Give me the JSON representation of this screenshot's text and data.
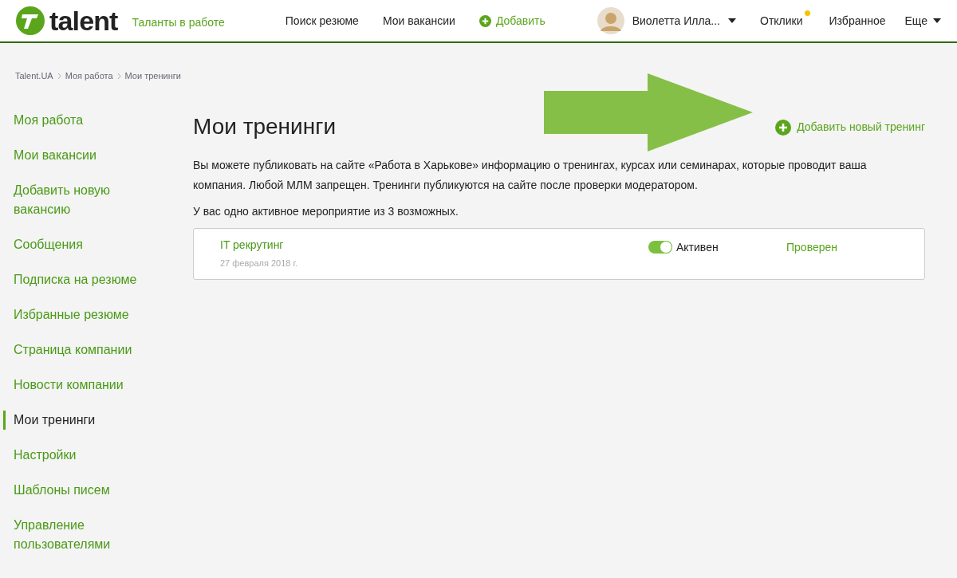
{
  "header": {
    "logo_text": "talent",
    "tagline": "Таланты в работе",
    "nav": [
      {
        "label": "Поиск резюме",
        "kind": "link"
      },
      {
        "label": "Мои вакансии",
        "kind": "link"
      },
      {
        "label": "Добавить",
        "kind": "add"
      }
    ],
    "user": {
      "name": "Виолетта Илла..."
    },
    "right_nav": [
      {
        "label": "Отклики",
        "notification": true,
        "dropdown": false
      },
      {
        "label": "Избранное",
        "notification": false,
        "dropdown": false
      },
      {
        "label": "Еще",
        "notification": false,
        "dropdown": true
      }
    ]
  },
  "breadcrumbs": [
    "Talent.UA",
    "Моя работа",
    "Мои тренинги"
  ],
  "sidebar": {
    "items": [
      {
        "label": "Моя работа",
        "selected": false
      },
      {
        "label": "Мои вакансии",
        "selected": false
      },
      {
        "label": "Добавить новую вакансию",
        "selected": false
      },
      {
        "label": "Сообщения",
        "selected": false
      },
      {
        "label": "Подписка на резюме",
        "selected": false
      },
      {
        "label": "Избранные резюме",
        "selected": false
      },
      {
        "label": "Страница компании",
        "selected": false
      },
      {
        "label": "Новости компании",
        "selected": false
      },
      {
        "label": "Мои тренинги",
        "selected": true
      },
      {
        "label": "Настройки",
        "selected": false
      },
      {
        "label": "Шаблоны писем",
        "selected": false
      },
      {
        "label": "Управление пользователями",
        "selected": false
      }
    ]
  },
  "main": {
    "title": "Мои тренинги",
    "add_link": "Добавить новый тренинг",
    "description": "Вы можете публиковать на сайте «Работа в Харькове» информацию о тренингах, курсах или семинарах, которые проводит ваша компания. Любой МЛМ запрещен. Тренинги публикуются на сайте после проверки модератором.",
    "summary": "У вас одно активное мероприятие из 3 возможных.",
    "trainings": [
      {
        "name": "IT рекрутинг",
        "date": "27 февраля 2018 г.",
        "active": true,
        "status_label": "Активен",
        "moderation": "Проверен"
      }
    ]
  }
}
